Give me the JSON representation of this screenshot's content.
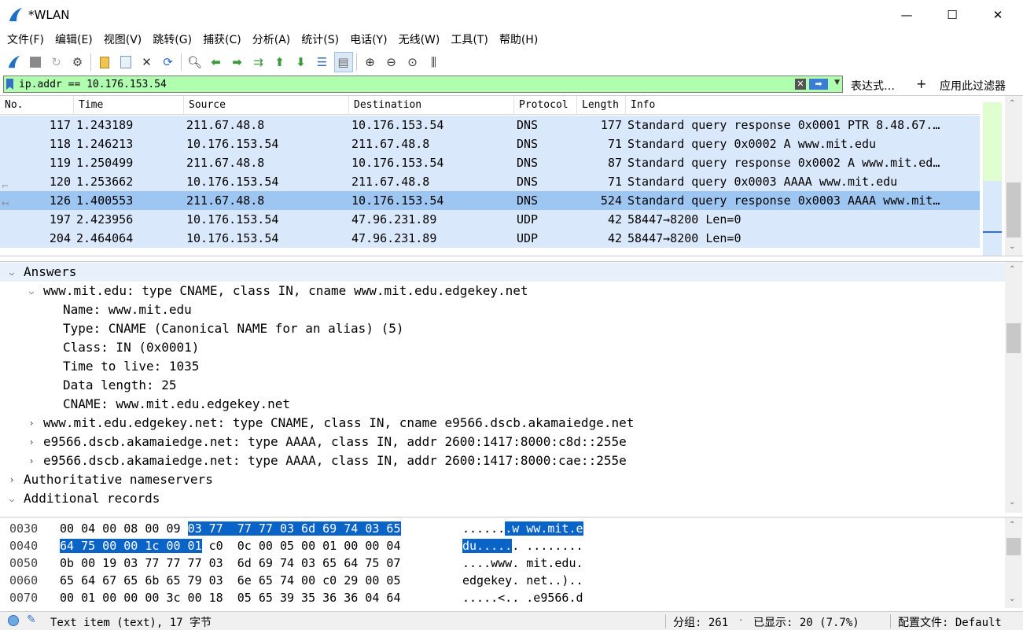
{
  "window": {
    "title": "*WLAN",
    "minimize": "—",
    "maximize": "☐",
    "close": "✕"
  },
  "menu": [
    "文件(F)",
    "编辑(E)",
    "视图(V)",
    "跳转(G)",
    "捕获(C)",
    "分析(A)",
    "统计(S)",
    "电话(Y)",
    "无线(W)",
    "工具(T)",
    "帮助(H)"
  ],
  "filter": {
    "value": "ip.addr == 10.176.153.54",
    "expression_label": "表达式…",
    "add_label": "+",
    "apply_label": "应用此过滤器"
  },
  "packet_list": {
    "columns": [
      "No.",
      "Time",
      "Source",
      "Destination",
      "Protocol",
      "Length",
      "Info"
    ],
    "rows": [
      {
        "no": "117",
        "time": "1.243189",
        "source": "211.67.48.8",
        "destination": "10.176.153.54",
        "protocol": "DNS",
        "length": "177",
        "info": "Standard query response 0x0001 PTR 8.48.67.…"
      },
      {
        "no": "118",
        "time": "1.246213",
        "source": "10.176.153.54",
        "destination": "211.67.48.8",
        "protocol": "DNS",
        "length": "71",
        "info": "Standard query 0x0002 A www.mit.edu"
      },
      {
        "no": "119",
        "time": "1.250499",
        "source": "211.67.48.8",
        "destination": "10.176.153.54",
        "protocol": "DNS",
        "length": "87",
        "info": "Standard query response 0x0002 A www.mit.ed…"
      },
      {
        "no": "120",
        "time": "1.253662",
        "source": "10.176.153.54",
        "destination": "211.67.48.8",
        "protocol": "DNS",
        "length": "71",
        "info": "Standard query 0x0003 AAAA www.mit.edu"
      },
      {
        "no": "126",
        "time": "1.400553",
        "source": "211.67.48.8",
        "destination": "10.176.153.54",
        "protocol": "DNS",
        "length": "524",
        "info": "Standard query response 0x0003 AAAA www.mit…"
      },
      {
        "no": "197",
        "time": "2.423956",
        "source": "10.176.153.54",
        "destination": "47.96.231.89",
        "protocol": "UDP",
        "length": "42",
        "info": "58447→8200 Len=0"
      },
      {
        "no": "204",
        "time": "2.464064",
        "source": "10.176.153.54",
        "destination": "47.96.231.89",
        "protocol": "UDP",
        "length": "42",
        "info": "58447→8200 Len=0"
      }
    ],
    "selected_row": "126"
  },
  "details": [
    {
      "text": "Answers",
      "level": 0,
      "arrow": "⌵"
    },
    {
      "text": "www.mit.edu: type CNAME, class IN, cname www.mit.edu.edgekey.net",
      "level": 1,
      "arrow": "⌵"
    },
    {
      "text": "Name: www.mit.edu",
      "level": 2,
      "arrow": ""
    },
    {
      "text": "Type: CNAME (Canonical NAME for an alias) (5)",
      "level": 2,
      "arrow": ""
    },
    {
      "text": "Class: IN (0x0001)",
      "level": 2,
      "arrow": ""
    },
    {
      "text": "Time to live: 1035",
      "level": 2,
      "arrow": ""
    },
    {
      "text": "Data length: 25",
      "level": 2,
      "arrow": ""
    },
    {
      "text": "CNAME: www.mit.edu.edgekey.net",
      "level": 2,
      "arrow": ""
    },
    {
      "text": "www.mit.edu.edgekey.net: type CNAME, class IN, cname e9566.dscb.akamaiedge.net",
      "level": 1,
      "arrow": "›"
    },
    {
      "text": "e9566.dscb.akamaiedge.net: type AAAA, class IN, addr 2600:1417:8000:c8d::255e",
      "level": 1,
      "arrow": "›"
    },
    {
      "text": "e9566.dscb.akamaiedge.net: type AAAA, class IN, addr 2600:1417:8000:cae::255e",
      "level": 1,
      "arrow": "›"
    },
    {
      "text": "Authoritative nameservers",
      "level": 0,
      "arrow": "›"
    },
    {
      "text": "Additional records",
      "level": 0,
      "arrow": "⌵"
    }
  ],
  "bytes": [
    {
      "offset": "0030",
      "hex_pre": "00 04 00 08 00 09 ",
      "hex_sel": "03 77  77 77 03 6d 69 74 03 65",
      "hex_post": "",
      "ascii_pre": "......",
      "ascii_sel": ".w ww.mit.e",
      "ascii_post": ""
    },
    {
      "offset": "0040",
      "hex_pre": "",
      "hex_sel": "64 75 00 00 1c 00 01",
      "hex_post": " c0  0c 00 05 00 01 00 00 04",
      "ascii_pre": "",
      "ascii_sel": "du.....",
      "ascii_post": ". ........"
    },
    {
      "offset": "0050",
      "hex_pre": "0b 00 19 03 77 77 77 03  6d 69 74 03 65 64 75 07",
      "hex_sel": "",
      "hex_post": "",
      "ascii_pre": "....www. mit.edu.",
      "ascii_sel": "",
      "ascii_post": ""
    },
    {
      "offset": "0060",
      "hex_pre": "65 64 67 65 6b 65 79 03  6e 65 74 00 c0 29 00 05",
      "hex_sel": "",
      "hex_post": "",
      "ascii_pre": "edgekey. net..)..",
      "ascii_sel": "",
      "ascii_post": ""
    },
    {
      "offset": "0070",
      "hex_pre": "00 01 00 00 00 3c 00 18  05 65 39 35 36 36 04 64",
      "hex_sel": "",
      "hex_post": "",
      "ascii_pre": ".....<.. .e9566.d",
      "ascii_sel": "",
      "ascii_post": ""
    }
  ],
  "status": {
    "item": "Text item (text), 17 字节",
    "packets": "分组: 261",
    "displayed": "已显示: 20 (7.7%)",
    "profile": "配置文件: Default"
  },
  "colors": {
    "row_bg": "#dae8fc",
    "row_selected": "#9ec6f3",
    "filter_ok": "#afffaf",
    "byte_highlight": "#0a64c8"
  }
}
